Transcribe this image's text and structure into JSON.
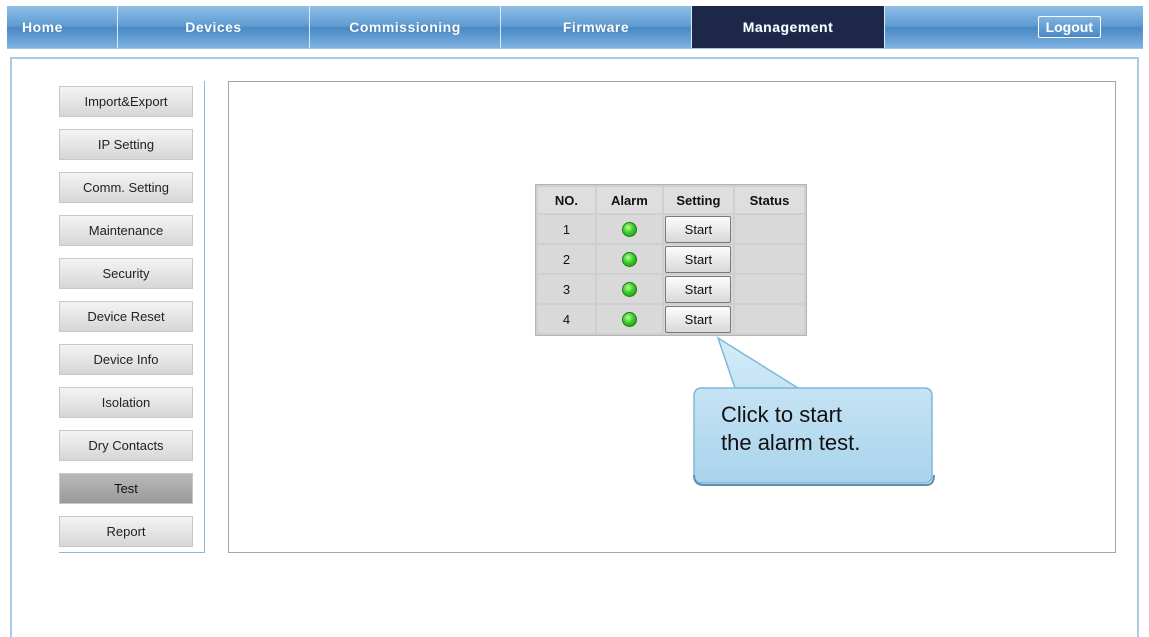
{
  "nav": {
    "tabs": [
      "Home",
      "Devices",
      "Commissioning",
      "Firmware",
      "Management"
    ],
    "active_tab": "Management",
    "logout_label": "Logout"
  },
  "sidebar": {
    "items": [
      {
        "label": "Import&Export"
      },
      {
        "label": "IP Setting"
      },
      {
        "label": "Comm. Setting"
      },
      {
        "label": "Maintenance"
      },
      {
        "label": "Security"
      },
      {
        "label": "Device Reset"
      },
      {
        "label": "Device Info"
      },
      {
        "label": "Isolation"
      },
      {
        "label": "Dry Contacts"
      },
      {
        "label": "Test"
      },
      {
        "label": "Report"
      }
    ],
    "active_item": "Test"
  },
  "alarm_table": {
    "headers": [
      "NO.",
      "Alarm",
      "Setting",
      "Status"
    ],
    "rows": [
      {
        "no": "1",
        "alarm": "green-led-icon",
        "setting": "Start",
        "status": ""
      },
      {
        "no": "2",
        "alarm": "green-led-icon",
        "setting": "Start",
        "status": ""
      },
      {
        "no": "3",
        "alarm": "green-led-icon",
        "setting": "Start",
        "status": ""
      },
      {
        "no": "4",
        "alarm": "green-led-icon",
        "setting": "Start",
        "status": ""
      }
    ]
  },
  "callout": {
    "line1": "Click to start",
    "line2": "the alarm test."
  },
  "colors": {
    "nav_bar": "#5e9bd2",
    "nav_active": "#1d2848",
    "frame_border": "#a9cbe8",
    "alarm_led": "#3ccc2a",
    "callout_fill": "#bde0f2",
    "callout_border": "#7fb8d8"
  }
}
